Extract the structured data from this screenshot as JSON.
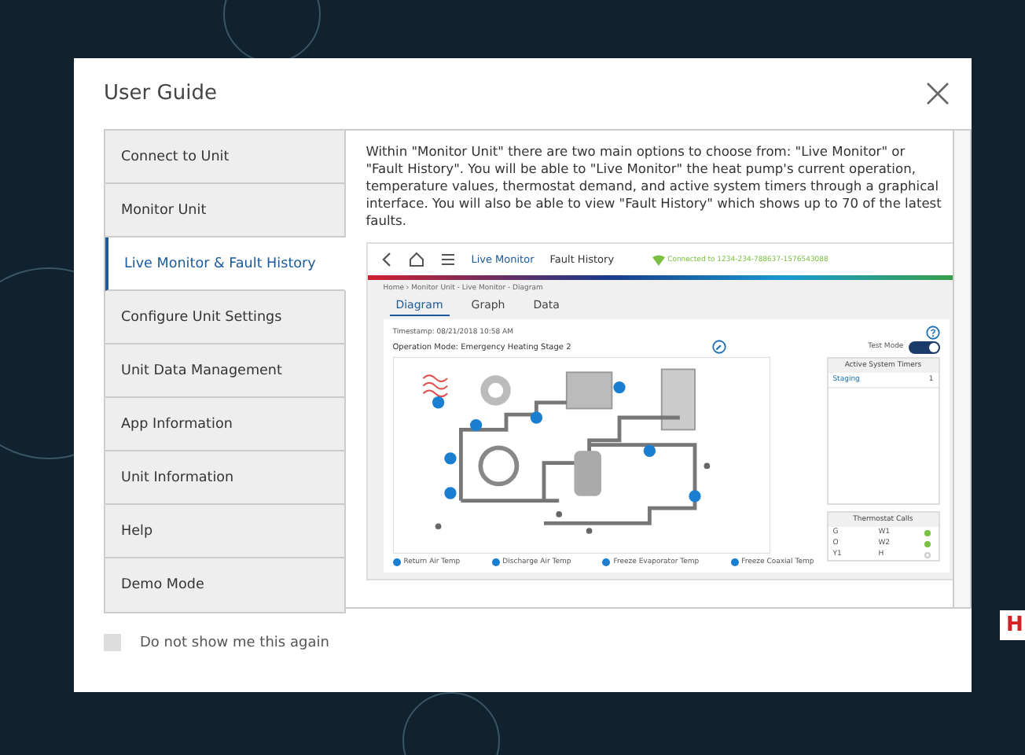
{
  "dialog": {
    "title": "User Guide"
  },
  "sidebar": {
    "items": [
      {
        "label": "Connect to Unit",
        "selected": false
      },
      {
        "label": "Monitor Unit",
        "selected": false
      },
      {
        "label": "Live Monitor & Fault History",
        "selected": true
      },
      {
        "label": "Configure Unit Settings",
        "selected": false
      },
      {
        "label": "Unit Data Management",
        "selected": false
      },
      {
        "label": "App Information",
        "selected": false
      },
      {
        "label": "Unit Information",
        "selected": false
      },
      {
        "label": "Help",
        "selected": false
      },
      {
        "label": "Demo Mode",
        "selected": false
      }
    ]
  },
  "content": {
    "paragraph": "Within \"Monitor Unit\" there are two main options to choose from: \"Live Monitor\" or \"Fault History\".  You will be able to \"Live Monitor\" the heat pump's current operation, temperature values, thermostat demand, and active system timers through a graphical interface. You will also be able to view \"Fault History\" which shows up to 70 of the latest faults.",
    "screenshot": {
      "nav_tabs": [
        {
          "label": "Live Monitor",
          "selected": true
        },
        {
          "label": "Fault History",
          "selected": false
        }
      ],
      "connection": "Connected to 1234-234-788637-1576543088",
      "breadcrumb": "Home › Monitor Unit - Live Monitor - Diagram",
      "view_tabs": [
        {
          "label": "Diagram",
          "selected": true
        },
        {
          "label": "Graph",
          "selected": false
        },
        {
          "label": "Data",
          "selected": false
        }
      ],
      "timestamp": "Timestamp: 08/21/2018 10:58 AM",
      "operation_mode": "Operation Mode: Emergency Heating Stage 2",
      "test_mode": {
        "label": "Test Mode",
        "on": true
      },
      "timers": {
        "title": "Active System Timers",
        "rows": [
          {
            "name": "Staging",
            "value": "1"
          }
        ]
      },
      "thermostat": {
        "title": "Thermostat Calls",
        "rows": [
          {
            "left": "G",
            "right": "W1",
            "active": true
          },
          {
            "left": "O",
            "right": "W2",
            "active": true
          },
          {
            "left": "Y1",
            "right": "H",
            "active": false
          }
        ]
      },
      "legend": [
        "Return Air Temp",
        "Discharge Air Temp",
        "Freeze Evaporator Temp",
        "Freeze Coaxial Temp"
      ]
    }
  },
  "footer": {
    "checkbox": {
      "label": "Do not show me this again",
      "checked": false
    }
  },
  "backdrop": {
    "logo_fragment": "H"
  }
}
